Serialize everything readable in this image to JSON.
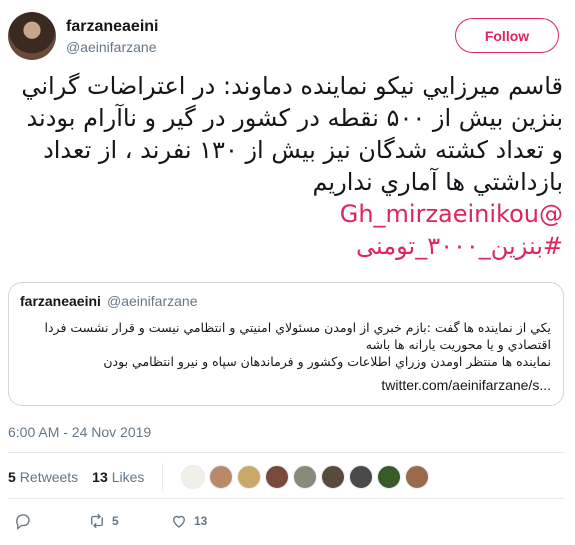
{
  "author": {
    "name": "farzaneaeini",
    "handle": "@aeinifarzane",
    "follow_label": "Follow",
    "accent_color": "#e0245e"
  },
  "tweet": {
    "text": "قاسم ميرزايي نيكو نماينده دماوند: در اعتراضات گراني بنزين بيش از ۵۰۰ نقطه در كشور در گير و ناآرام بودند و تعداد كشته شدگان نيز بيش از ۱۳۰ نفرند ، از تعداد بازداشتي ها آماري نداريم",
    "mention": "@Gh_mirzaeinikou",
    "hashtag": "#بنزين_۳۰۰۰_تومنى"
  },
  "quoted": {
    "name": "farzaneaeini",
    "handle": "@aeinifarzane",
    "line1": "يكي از نماينده ها گفت :بازم خبري از اومدن مسئولاي امنيتي و انتظامي نيست و قرار نشست فردا اقتصادي و يا محوريت يارانه ها باشه",
    "line2": "نماينده ها منتظر اومدن وزراي اطلاعات وكشور و فرماندهان سپاه و نيرو انتظامي بودن",
    "link": "twitter.com/aeinifarzane/s..."
  },
  "timestamp": "6:00 AM - 24 Nov 2019",
  "stats": {
    "retweets_count": "5",
    "retweets_label": "Retweets",
    "likes_count": "13",
    "likes_label": "Likes"
  },
  "actions": {
    "reply_icon": "reply-icon",
    "retweet_icon": "retweet-icon",
    "retweet_count": "5",
    "like_icon": "heart-icon",
    "like_count": "13"
  }
}
